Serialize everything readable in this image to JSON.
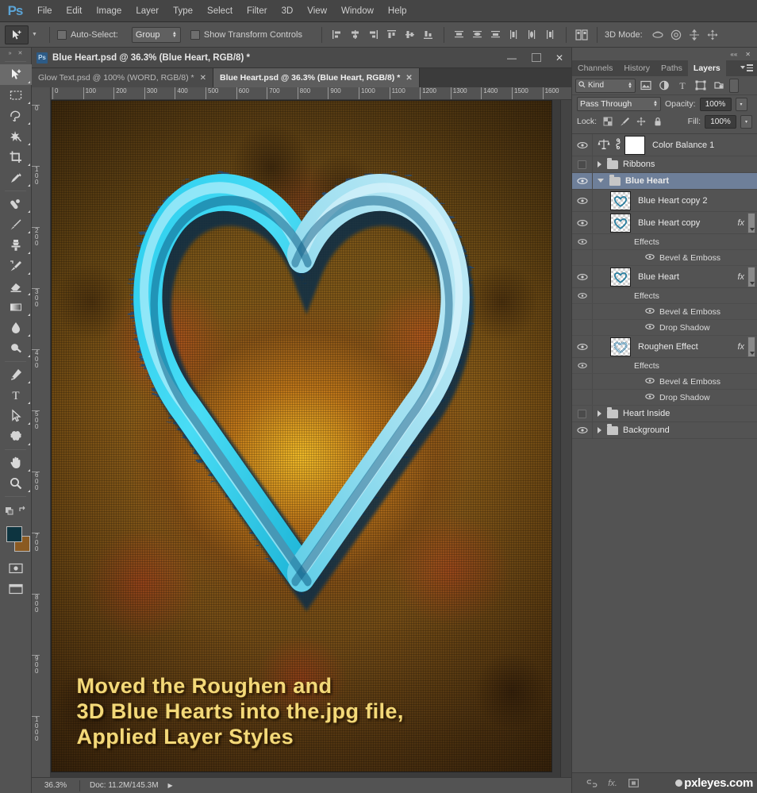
{
  "app": {
    "logo": "Ps",
    "menus": [
      "File",
      "Edit",
      "Image",
      "Layer",
      "Type",
      "Select",
      "Filter",
      "3D",
      "View",
      "Window",
      "Help"
    ]
  },
  "options_bar": {
    "tool_icon": "move-tool-icon",
    "auto_select_label": "Auto-Select:",
    "auto_select_value": "Group",
    "show_transform_label": "Show Transform Controls",
    "mode_3d_label": "3D Mode:",
    "align_icons": [
      "align-left-edges-icon",
      "align-horizontal-centers-icon",
      "align-right-edges-icon",
      "align-top-edges-icon",
      "align-vertical-centers-icon",
      "align-bottom-edges-icon"
    ],
    "distribute_icons": [
      "distribute-top-edges-icon",
      "distribute-vertical-centers-icon",
      "distribute-bottom-edges-icon",
      "distribute-left-edges-icon",
      "distribute-horizontal-centers-icon",
      "distribute-right-edges-icon"
    ],
    "arrange_icon": "auto-align-layers-icon",
    "mode_3d_icons": [
      "rotate-3d-object-icon",
      "roll-3d-object-icon",
      "drag-3d-object-icon",
      "slide-3d-object-icon"
    ]
  },
  "toolbar": {
    "tools": [
      {
        "name": "move-tool",
        "active": true
      },
      {
        "name": "rectangular-marquee-tool",
        "active": false
      },
      {
        "name": "lasso-tool",
        "active": false
      },
      {
        "name": "quick-selection-tool",
        "active": false
      },
      {
        "name": "crop-tool",
        "active": false
      },
      {
        "name": "eyedropper-tool",
        "active": false
      },
      {
        "name": "spot-healing-brush-tool",
        "active": false
      },
      {
        "name": "brush-tool",
        "active": false
      },
      {
        "name": "clone-stamp-tool",
        "active": false
      },
      {
        "name": "history-brush-tool",
        "active": false
      },
      {
        "name": "eraser-tool",
        "active": false
      },
      {
        "name": "gradient-tool",
        "active": false
      },
      {
        "name": "blur-tool",
        "active": false
      },
      {
        "name": "dodge-tool",
        "active": false
      },
      {
        "name": "pen-tool",
        "active": false
      },
      {
        "name": "horizontal-type-tool",
        "active": false
      },
      {
        "name": "path-selection-tool",
        "active": false
      },
      {
        "name": "custom-shape-tool",
        "active": false
      },
      {
        "name": "hand-tool",
        "active": false
      },
      {
        "name": "zoom-tool",
        "active": false
      }
    ],
    "foreground_color": "#0d3440",
    "background_color": "#8a5a22"
  },
  "document_window": {
    "title": "Blue Heart.psd @ 36.3% (Blue Heart, RGB/8) *",
    "minimize_label": "—",
    "maximize_label": "",
    "close_label": "✕",
    "tabs": [
      {
        "label": "Glow Text.psd @ 100% (WORD, RGB/8) *",
        "active": false,
        "close": "✕"
      },
      {
        "label": "Blue Heart.psd @ 36.3% (Blue Heart, RGB/8) *",
        "active": true,
        "close": "✕"
      }
    ],
    "ruler_h_ticks": [
      "0",
      "100",
      "200",
      "300",
      "400",
      "500",
      "600",
      "700",
      "800",
      "900",
      "1000",
      "1100",
      "1200",
      "1300",
      "1400",
      "1500",
      "1600"
    ],
    "ruler_v_ticks": [
      "0",
      "100",
      "200",
      "300",
      "400",
      "500",
      "600",
      "700",
      "800",
      "900",
      "1000"
    ],
    "status": {
      "zoom": "36.3%",
      "doc_info": "Doc: 11.2M/145.3M",
      "arrow": "▶"
    }
  },
  "artwork": {
    "caption_lines": [
      "Moved the Roughen and",
      "3D Blue Hearts into the.jpg file,",
      "Applied Layer Styles"
    ],
    "caption_color": "#f3d979",
    "heart_color_light": "#9fe4f4",
    "heart_color_mid": "#2ec6e8",
    "heart_color_dark": "#17678f",
    "background_colors": [
      "#7a5518",
      "#8a5c18",
      "#5e3d14"
    ]
  },
  "panels": {
    "collapse_icon": "collapse-panels-icon",
    "close_icon": "close-icon",
    "tabs": [
      {
        "label": "Channels",
        "active": false
      },
      {
        "label": "History",
        "active": false
      },
      {
        "label": "Paths",
        "active": false
      },
      {
        "label": "Layers",
        "active": true
      }
    ],
    "menu_icon": "panel-menu-icon"
  },
  "layers_panel": {
    "filter": {
      "kind_label": "Kind",
      "search_icon": "search-icon",
      "filter_icons": [
        "filter-pixel-layers-icon",
        "filter-adjustment-layers-icon",
        "filter-type-layers-icon",
        "filter-shape-layers-icon",
        "filter-smart-objects-icon"
      ],
      "toggle_icon": "filter-toggle-icon"
    },
    "blend_mode": "Pass Through",
    "opacity_label": "Opacity:",
    "opacity_value": "100%",
    "lock_label": "Lock:",
    "lock_icons": [
      "lock-transparent-pixels-icon",
      "lock-image-pixels-icon",
      "lock-position-icon",
      "lock-all-icon"
    ],
    "fill_label": "Fill:",
    "fill_value": "100%",
    "rows": [
      {
        "type": "layer",
        "name": "Color Balance 1",
        "visible": true,
        "selected": false,
        "thumb": "white",
        "adjustment": true,
        "link": true,
        "fx": false
      },
      {
        "type": "group",
        "name": "Ribbons",
        "visible": false,
        "selected": false,
        "expanded": false
      },
      {
        "type": "group",
        "name": "Blue Heart",
        "visible": true,
        "selected": true,
        "expanded": true
      },
      {
        "type": "layer",
        "name": "Blue Heart copy 2",
        "visible": true,
        "selected": false,
        "thumb": "heart",
        "fx": false,
        "indent": true
      },
      {
        "type": "layer",
        "name": "Blue Heart copy",
        "visible": true,
        "selected": false,
        "thumb": "heart",
        "fx": true,
        "indent": true
      },
      {
        "type": "effects-header",
        "name": "Effects",
        "visible": true
      },
      {
        "type": "effect",
        "name": "Bevel & Emboss",
        "visible": true
      },
      {
        "type": "layer",
        "name": "Blue Heart",
        "visible": true,
        "selected": false,
        "thumb": "heart",
        "fx": true,
        "indent": true
      },
      {
        "type": "effects-header",
        "name": "Effects",
        "visible": true
      },
      {
        "type": "effect",
        "name": "Bevel & Emboss",
        "visible": true
      },
      {
        "type": "effect",
        "name": "Drop Shadow",
        "visible": true
      },
      {
        "type": "layer",
        "name": "Roughen Effect",
        "visible": true,
        "selected": false,
        "thumb": "heart-rough",
        "fx": true,
        "indent": true
      },
      {
        "type": "effects-header",
        "name": "Effects",
        "visible": true
      },
      {
        "type": "effect",
        "name": "Bevel & Emboss",
        "visible": true
      },
      {
        "type": "effect",
        "name": "Drop Shadow",
        "visible": true
      },
      {
        "type": "group",
        "name": "Heart Inside",
        "visible": false,
        "selected": false,
        "expanded": false
      },
      {
        "type": "group",
        "name": "Background",
        "visible": true,
        "selected": false,
        "expanded": false
      }
    ],
    "bottom_icons": [
      "link-layers-icon",
      "add-layer-style-icon",
      "add-layer-mask-icon"
    ],
    "watermark": "pxleyes.com"
  }
}
